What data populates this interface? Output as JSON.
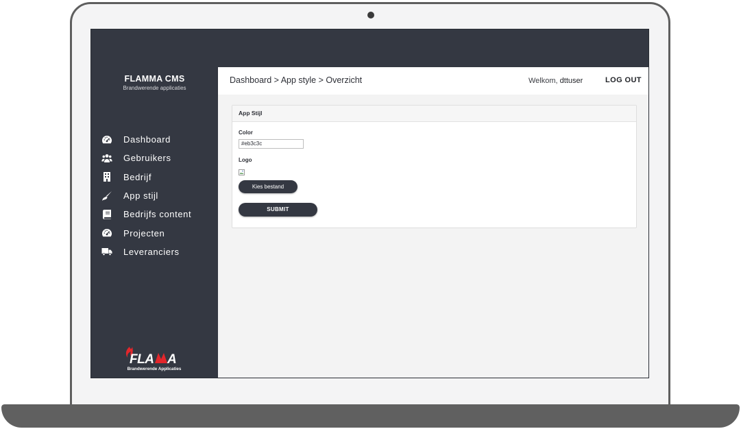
{
  "sidebar": {
    "title": "FLAMMA CMS",
    "subtitle": "Brandwerende applicaties",
    "items": [
      {
        "label": "Dashboard",
        "icon": "gauge-icon"
      },
      {
        "label": "Gebruikers",
        "icon": "users-icon"
      },
      {
        "label": "Bedrijf",
        "icon": "building-icon"
      },
      {
        "label": "App stijl",
        "icon": "brush-icon"
      },
      {
        "label": "Bedrijfs content",
        "icon": "book-icon"
      },
      {
        "label": "Projecten",
        "icon": "gauge-icon"
      },
      {
        "label": "Leveranciers",
        "icon": "truck-icon"
      }
    ],
    "logo_text": "FLAMMA",
    "logo_sub": "Brandwerende Applicaties"
  },
  "header": {
    "breadcrumb": "Dashboard > App style > Overzicht",
    "welcome_prefix": "Welkom,",
    "username": "dttuser",
    "logout_label": "LOG OUT"
  },
  "form": {
    "panel_title": "App Stijl",
    "color_label": "Color",
    "color_value": "#eb3c3c",
    "logo_label": "Logo",
    "file_button_label": "Kies bestand",
    "submit_label": "SUBMIT"
  },
  "colors": {
    "sidebar_bg": "#343842",
    "brand_red": "#e3262b"
  }
}
